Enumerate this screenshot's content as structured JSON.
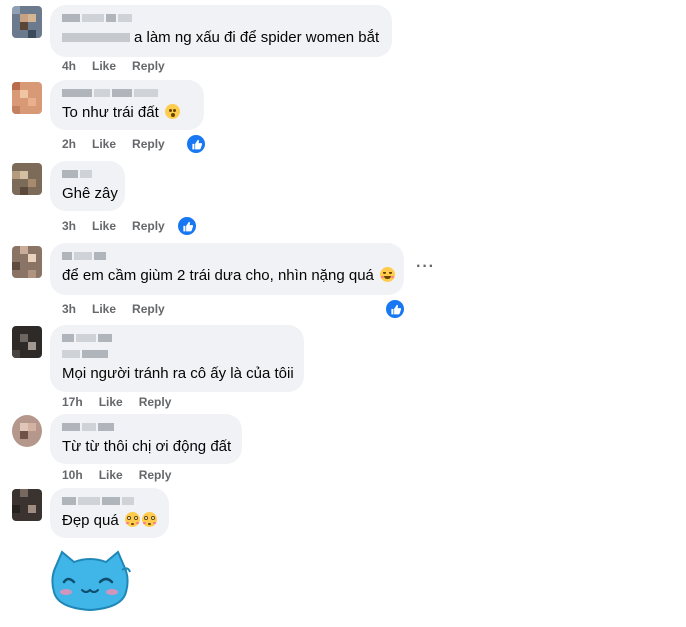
{
  "comments": [
    {
      "text": "a làm ng xấu đi để spider women bắt",
      "time": "4h",
      "like": "Like",
      "reply": "Reply"
    },
    {
      "text": "To như trái đất",
      "time": "2h",
      "like": "Like",
      "reply": "Reply"
    },
    {
      "text": "Ghê zây",
      "time": "3h",
      "like": "Like",
      "reply": "Reply"
    },
    {
      "text": "để em cầm giùm 2 trái dưa cho, nhìn nặng quá",
      "time": "3h",
      "like": "Like",
      "reply": "Reply"
    },
    {
      "text": "Mọi người tránh ra cô ấy là của tôii",
      "time": "17h",
      "like": "Like",
      "reply": "Reply"
    },
    {
      "text": "Từ từ thôi chị ơi động đất",
      "time": "10h",
      "like": "Like",
      "reply": "Reply"
    },
    {
      "text": "Đẹp quá",
      "time": "",
      "like": "",
      "reply": ""
    }
  ],
  "more_menu": "···",
  "icons": {
    "like_reaction": "thumbs-up-icon",
    "emoji_hushed": "hushed-face-emoji",
    "emoji_smile": "smiling-face-emoji",
    "emoji_flushed": "flushed-face-emoji",
    "sticker": "blue-cat-sticker"
  },
  "colors": {
    "bubble": "#f0f2f5",
    "meta_text": "#65676b",
    "like_blue": "#1877f2"
  }
}
